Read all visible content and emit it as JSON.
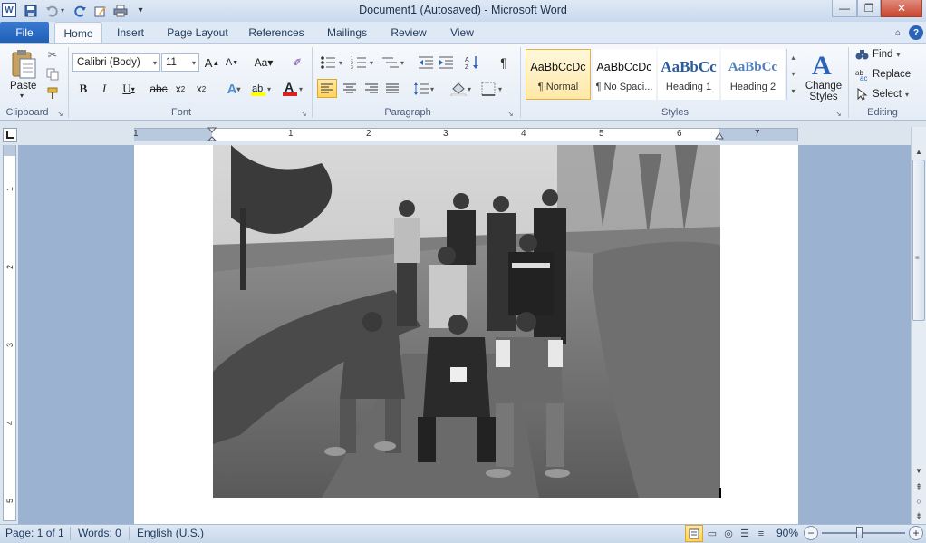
{
  "window": {
    "title": "Document1 (Autosaved)  -  Microsoft Word",
    "controls": {
      "minimize": "—",
      "restore": "❐",
      "close": "✕"
    }
  },
  "qat": {
    "icons": [
      "word-logo-icon",
      "save-icon",
      "undo-icon",
      "redo-icon",
      "edit-icon",
      "print-icon",
      "customize-qat-icon"
    ]
  },
  "tabs": {
    "file": "File",
    "items": [
      "Home",
      "Insert",
      "Page Layout",
      "References",
      "Mailings",
      "Review",
      "View"
    ],
    "active": "Home"
  },
  "clipboard": {
    "paste_label": "Paste",
    "group_label": "Clipboard"
  },
  "font": {
    "name": "Calibri (Body)",
    "size": "11",
    "group_label": "Font"
  },
  "paragraph": {
    "group_label": "Paragraph"
  },
  "styles": {
    "group_label": "Styles",
    "items": [
      {
        "sample": "AaBbCcDc",
        "name": "¶ Normal"
      },
      {
        "sample": "AaBbCcDc",
        "name": "¶ No Spaci..."
      },
      {
        "sample": "AaBbCc",
        "name": "Heading 1"
      },
      {
        "sample": "AaBbCc",
        "name": "Heading 2"
      }
    ],
    "change_styles": {
      "line1": "Change",
      "line2": "Styles"
    }
  },
  "editing": {
    "group_label": "Editing",
    "find": "Find",
    "replace": "Replace",
    "select": "Select"
  },
  "ruler": {
    "numbers": [
      "1",
      "1",
      "2",
      "3",
      "4",
      "5",
      "6",
      "7"
    ]
  },
  "vruler": {
    "numbers": [
      "1",
      "2",
      "3",
      "4",
      "5"
    ]
  },
  "status": {
    "page": "Page: 1 of 1",
    "words": "Words: 0",
    "language": "English (U.S.)",
    "zoom": "90%"
  },
  "colors": {
    "accent": "#2b579a",
    "file_tab": "#2a6ac8"
  }
}
